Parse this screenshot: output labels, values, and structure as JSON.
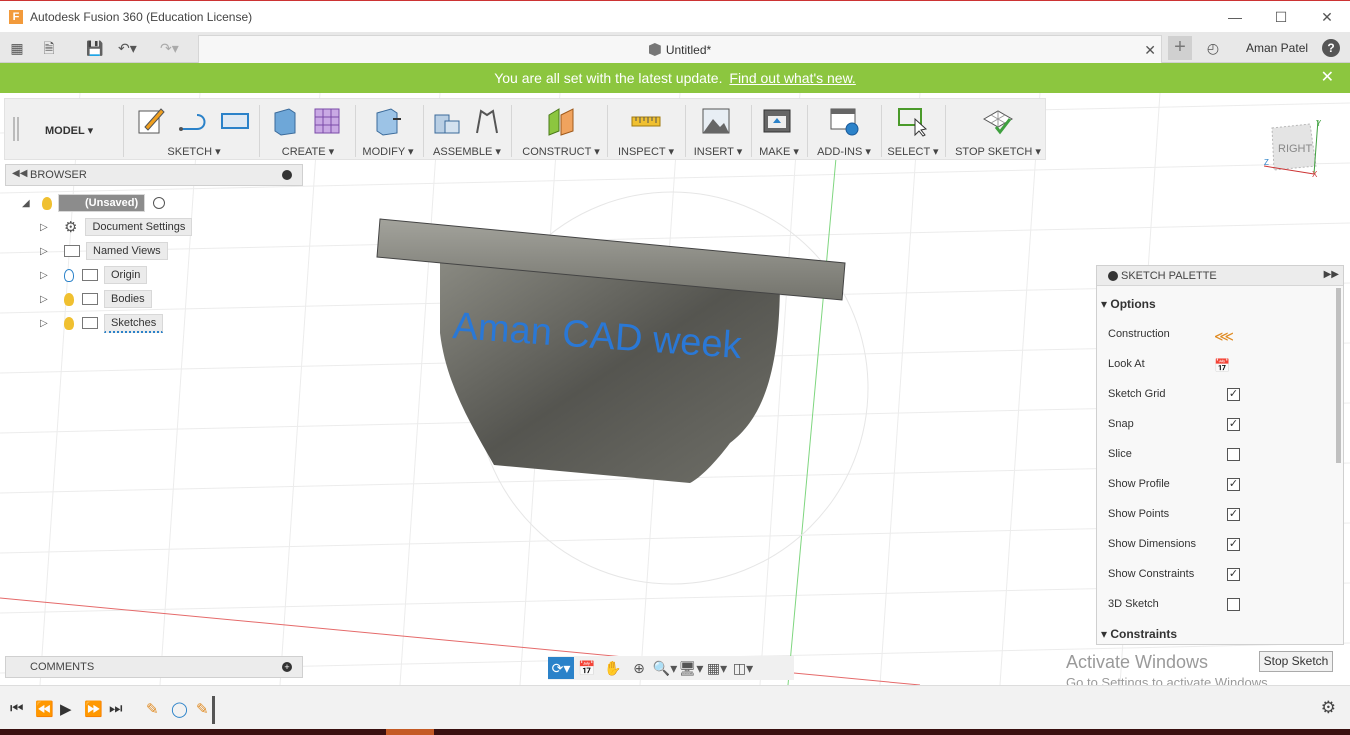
{
  "window": {
    "title": "Autodesk Fusion 360 (Education License)",
    "app_icon": "F"
  },
  "appbar": {
    "doc_title": "Untitled*",
    "user_name": "Aman Patel"
  },
  "notification": {
    "text": "You are all set with the latest update.",
    "link": "Find out what's new."
  },
  "toolbar": {
    "workspace": "MODEL",
    "groups": {
      "sketch": "SKETCH",
      "create": "CREATE",
      "modify": "MODIFY",
      "assemble": "ASSEMBLE",
      "construct": "CONSTRUCT",
      "inspect": "INSPECT",
      "insert": "INSERT",
      "make": "MAKE",
      "addins": "ADD-INS",
      "select": "SELECT",
      "stop_sketch": "STOP SKETCH"
    }
  },
  "browser": {
    "title": "BROWSER",
    "root": "(Unsaved)",
    "items": [
      "Document Settings",
      "Named Views",
      "Origin",
      "Bodies",
      "Sketches"
    ]
  },
  "viewport": {
    "model_text": "Aman CAD week",
    "viewcube_label": "RIGHT"
  },
  "palette": {
    "title": "SKETCH PALETTE",
    "options_header": "Options",
    "constraints_header": "Constraints",
    "options": [
      {
        "label": "Construction",
        "kind": "icon"
      },
      {
        "label": "Look At",
        "kind": "icon"
      },
      {
        "label": "Sketch Grid",
        "kind": "checkbox",
        "checked": true
      },
      {
        "label": "Snap",
        "kind": "checkbox",
        "checked": true
      },
      {
        "label": "Slice",
        "kind": "checkbox",
        "checked": false
      },
      {
        "label": "Show Profile",
        "kind": "checkbox",
        "checked": true
      },
      {
        "label": "Show Points",
        "kind": "checkbox",
        "checked": true
      },
      {
        "label": "Show Dimensions",
        "kind": "checkbox",
        "checked": true
      },
      {
        "label": "Show Constraints",
        "kind": "checkbox",
        "checked": true
      },
      {
        "label": "3D Sketch",
        "kind": "checkbox",
        "checked": false
      }
    ]
  },
  "comments": {
    "title": "COMMENTS"
  },
  "stop_sketch_button": "Stop Sketch",
  "watermark": {
    "line1": "Activate Windows",
    "line2": "Go to Settings to activate Windows."
  },
  "colors": {
    "accent": "#2b82c9",
    "notify": "#8cc63f",
    "model_text": "#2a78d6"
  }
}
